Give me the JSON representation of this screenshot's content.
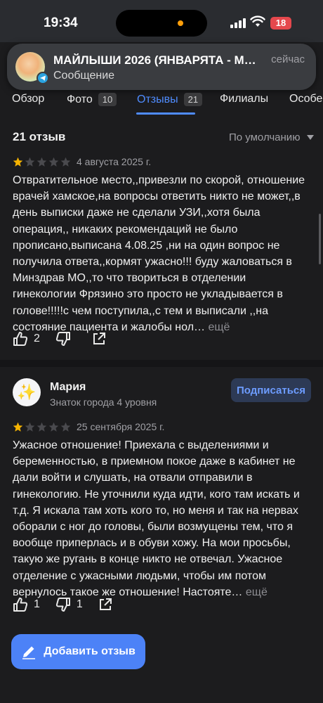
{
  "status_bar": {
    "time": "19:34",
    "battery": "18"
  },
  "notification": {
    "title": "МАЙЛЫШИ 2026 (ЯНВАРЯТА - МАЙ...",
    "subtitle": "Сообщение",
    "time": "сейчас",
    "app_icon": "telegram-icon"
  },
  "tabs": [
    {
      "label": "Обзор"
    },
    {
      "label": "Фото",
      "count": "10"
    },
    {
      "label": "Отзывы",
      "count": "21",
      "active": true
    },
    {
      "label": "Филиалы"
    },
    {
      "label": "Особе"
    }
  ],
  "reviews": {
    "count_label": "21 отзыв",
    "sort_label": "По умолчанию",
    "more_label": "ещё",
    "items": [
      {
        "rating": 1,
        "date": "4 августа 2025 г.",
        "text": "Отвратительное место,,привезли по скорой, отношение врачей хамское,на вопросы ответить никто не может,,в день выписки даже не сделали УЗИ,,хотя была операция,, никаких рекомендаций не было прописано,выписана 4.08.25 ,ни на один вопрос не получила ответа,,кормят ужасно!!! буду жаловаться в Минздрав МО,,то что твориться в отделении гинекологии Фрязино это просто не укладывается в голове!!!!!с чем поступила,,с тем и выписали ,,на состояние пациента и жалобы нол…",
        "likes": "2",
        "dislikes": ""
      },
      {
        "author": "Мария",
        "level": "Знаток города 4 уровня",
        "subscribe_label": "Подписаться",
        "rating": 1,
        "date": "25 сентября 2025 г.",
        "text": "Ужасное отношение! Приехала с выделениями и беременностью, в приемном покое даже в кабинет не дали войти и слушать, на отвали отправили в гинекологию. Не уточнили куда идти, кого там искать и т.д. Я искала там хоть кого то, но меня и так на нервах оборали с ног до головы, были возмущены тем, что я вообще приперлась и в обуви хожу. На мои просьбы, такую же ругань в конце никто не отвечал. Ужасное отделение с ужасными людьми, чтобы им потом вернулось такое же отношение! Настояте…",
        "likes": "1",
        "dislikes": "1"
      }
    ]
  },
  "add_review_label": "Добавить отзыв",
  "colors": {
    "accent": "#4c82f7",
    "star_filled": "#f5b301",
    "star_empty": "#4a4a4e",
    "background": "#1c1c1e"
  }
}
